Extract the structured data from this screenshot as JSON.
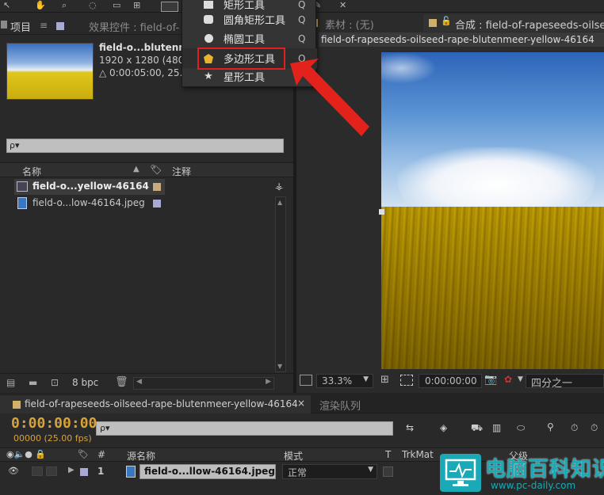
{
  "toolbar": {
    "shape_menu": {
      "items": [
        {
          "label": "矩形工具",
          "key": "Q",
          "icon": "rectangle-icon"
        },
        {
          "label": "圆角矩形工具",
          "key": "Q",
          "icon": "rounded-rect-icon"
        },
        {
          "label": "椭圆工具",
          "key": "Q",
          "icon": "ellipse-icon"
        },
        {
          "label": "多边形工具",
          "key": "Q",
          "icon": "polygon-icon",
          "highlighted": true
        },
        {
          "label": "星形工具",
          "key": "",
          "icon": "star-icon"
        }
      ]
    }
  },
  "project_panel": {
    "tab_label": "项目",
    "effects_tab": "效果控件 : field-of-",
    "preview": {
      "name": "field-o...blutenm",
      "resolution": "1920 x 1280  (480",
      "duration": "△ 0:00:05:00, 25."
    },
    "search_placeholder": "ρ▾",
    "columns": {
      "name": "名称",
      "comment": "注释"
    },
    "items": [
      {
        "name": "field-o...yellow-46164",
        "type": "composition",
        "bold": true
      },
      {
        "name": "field-o...low-46164.jpeg",
        "type": "image",
        "bold": false
      }
    ],
    "footer": {
      "bpc": "8 bpc"
    }
  },
  "viewer": {
    "footage_tab": "素材 : (无)",
    "comp_tab": "合成 : field-of-rapeseeds-oilse",
    "comp_path": "field-of-rapeseeds-oilseed-rape-blutenmeer-yellow-46164",
    "zoom": "33.3%",
    "timecode": "0:00:00:00",
    "resolution": "四分之一"
  },
  "timeline": {
    "tab_label": "field-of-rapeseeds-oilseed-rape-blutenmeer-yellow-46164",
    "render_queue_tab": "渲染队列",
    "current_time": "0:00:00:00",
    "frame_info": "00000 (25.00 fps)",
    "search_placeholder": "ρ▾",
    "columns": {
      "hash": "#",
      "source_name": "源名称",
      "mode": "模式",
      "t": "T",
      "trkmat": "TrkMat",
      "parent": "父级"
    },
    "layers": [
      {
        "index": "1",
        "name": "field-o...llow-46164.jpeg",
        "mode": "正常"
      }
    ]
  },
  "watermark": {
    "title": "电脑百科知识",
    "url": "www.pc-daily.com"
  },
  "colors": {
    "accent_orange": "#d8a23a",
    "highlight_red": "#e02020",
    "sky_blue": "#3f7ec9",
    "rapeseed_yellow": "#d6c21a",
    "watermark_teal": "#1aa9b6"
  }
}
